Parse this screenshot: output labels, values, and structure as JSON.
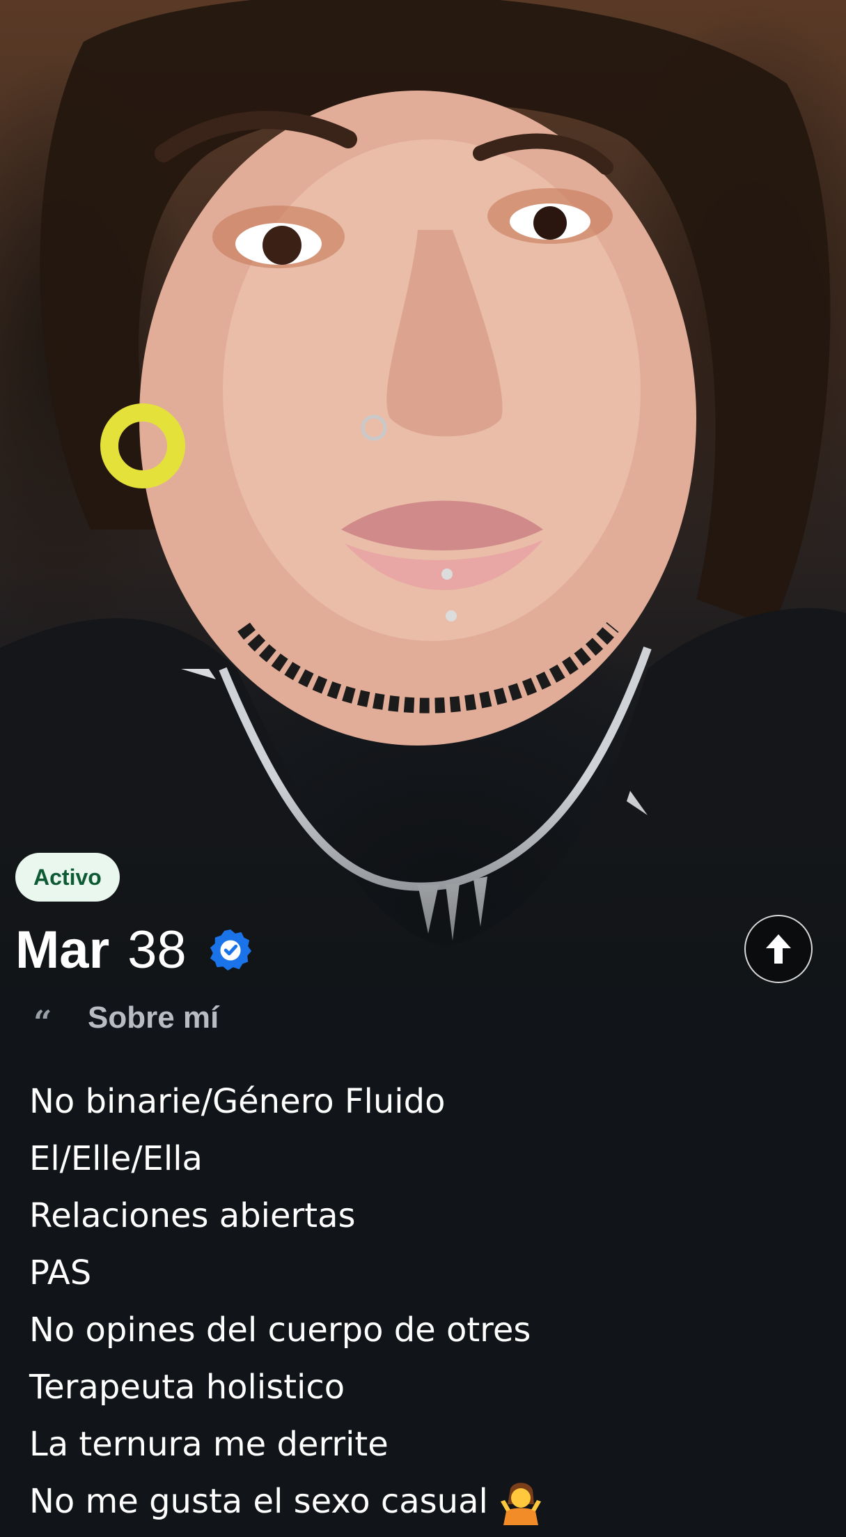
{
  "profile": {
    "status": "Activo",
    "name": "Mar",
    "age": "38",
    "verified": true
  },
  "about": {
    "heading": "Sobre mí",
    "lines": [
      "No binarie/Género Fluido",
      "El/Elle/Ella",
      "Relaciones abiertas",
      "PAS",
      "No opines del cuerpo de otres",
      "Terapeuta holistico",
      "La ternura me derrite",
      "No me gusta el sexo casual"
    ],
    "trailing_emoji": "person-shrugging-emoji"
  },
  "icons": {
    "verified": "verified-check-icon",
    "expand": "arrow-up-icon",
    "quote": "quote-icon"
  },
  "colors": {
    "background": "#111418",
    "badge_bg": "#e9f7ee",
    "badge_text": "#0e5a34",
    "verified_blue": "#1a73e8"
  }
}
